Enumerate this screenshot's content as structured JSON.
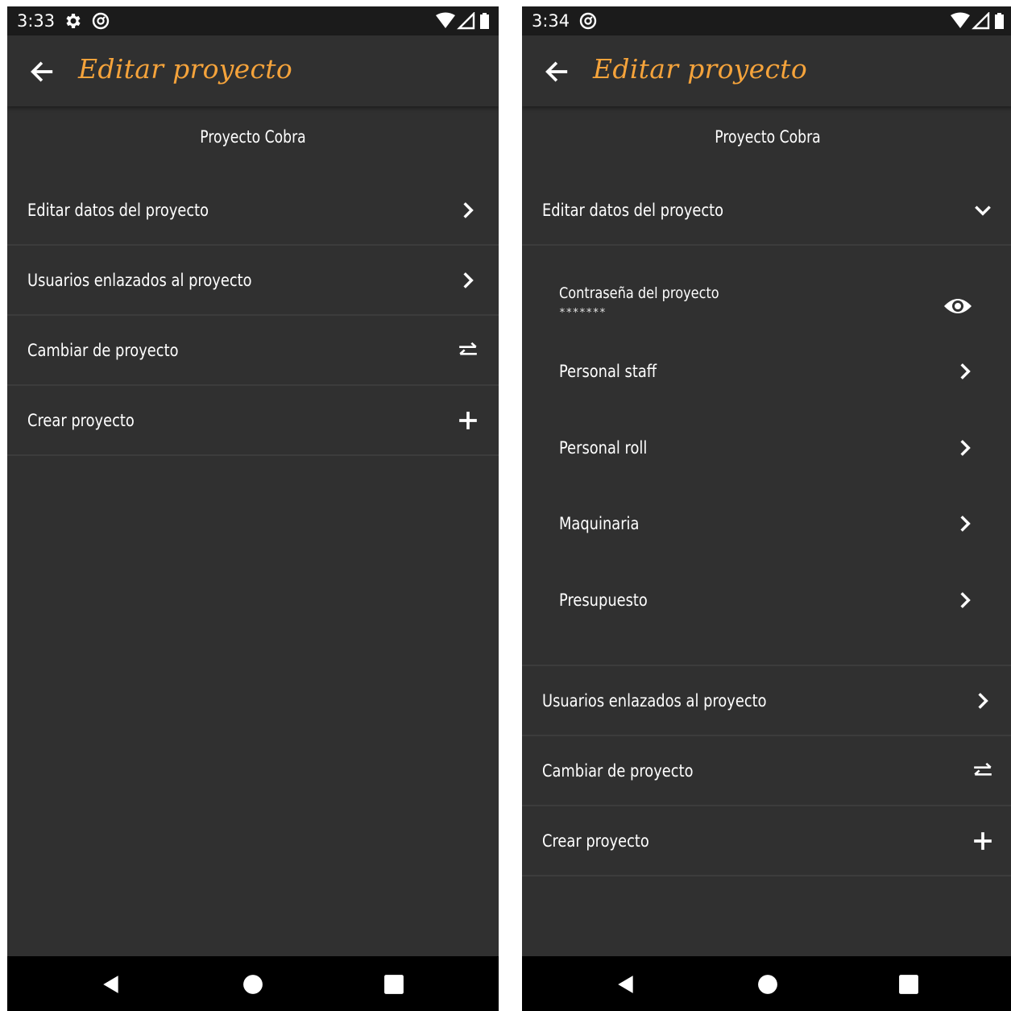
{
  "left_screen": {
    "status": {
      "time": "3:33"
    },
    "app_bar": {
      "title": "Editar proyecto"
    },
    "project_name": "Proyecto Cobra",
    "menu": [
      {
        "label": "Editar datos del proyecto",
        "icon": "chevron-right-icon"
      },
      {
        "label": "Usuarios enlazados al proyecto",
        "icon": "chevron-right-icon"
      },
      {
        "label": "Cambiar de proyecto",
        "icon": "swap-icon"
      },
      {
        "label": "Crear proyecto",
        "icon": "plus-icon"
      }
    ]
  },
  "right_screen": {
    "status": {
      "time": "3:34"
    },
    "app_bar": {
      "title": "Editar proyecto"
    },
    "project_name": "Proyecto Cobra",
    "expanded_item": {
      "label": "Editar datos del proyecto",
      "icon": "chevron-down-icon",
      "password": {
        "label": "Contraseña del proyecto",
        "value": "*******",
        "icon": "eye-icon"
      },
      "subitems": [
        {
          "label": "Personal staff",
          "icon": "chevron-right-icon"
        },
        {
          "label": "Personal roll",
          "icon": "chevron-right-icon"
        },
        {
          "label": "Maquinaria",
          "icon": "chevron-right-icon"
        },
        {
          "label": "Presupuesto",
          "icon": "chevron-right-icon"
        }
      ]
    },
    "menu": [
      {
        "label": "Usuarios enlazados al proyecto",
        "icon": "chevron-right-icon"
      },
      {
        "label": "Cambiar de proyecto",
        "icon": "swap-icon"
      },
      {
        "label": "Crear proyecto",
        "icon": "plus-icon"
      }
    ]
  },
  "colors": {
    "background": "#303030",
    "status_bar": "#1b1b1b",
    "accent_title": "#f5a33b",
    "text": "#ffffff",
    "divider": "#3c3c3c",
    "nav_bar": "#000000"
  }
}
